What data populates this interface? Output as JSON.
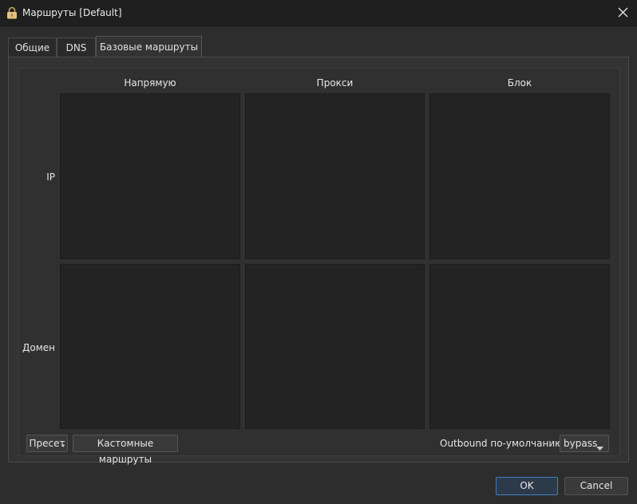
{
  "window": {
    "title": "Маршруты [Default]",
    "app_icon": "lock-icon",
    "close_icon": "close-icon"
  },
  "tabs": [
    {
      "label": "Общие",
      "active": false
    },
    {
      "label": "DNS",
      "active": false
    },
    {
      "label": "Базовые маршруты",
      "active": true
    }
  ],
  "routes": {
    "columns": [
      "Напрямую",
      "Прокси",
      "Блок"
    ],
    "rows": [
      "IP",
      "Домен"
    ]
  },
  "footer": {
    "preset_label": "Пресет",
    "custom_routes_label": "Кастомные маршруты",
    "outbound_label": "Outbound по-умолчанию",
    "outbound_value": "bypass"
  },
  "dialog_buttons": {
    "ok": "OK",
    "cancel": "Cancel"
  },
  "colors": {
    "background": "#2d2d2d",
    "titlebar": "#1f1f1f",
    "cell": "#232323",
    "accent": "#3e7fc1"
  }
}
